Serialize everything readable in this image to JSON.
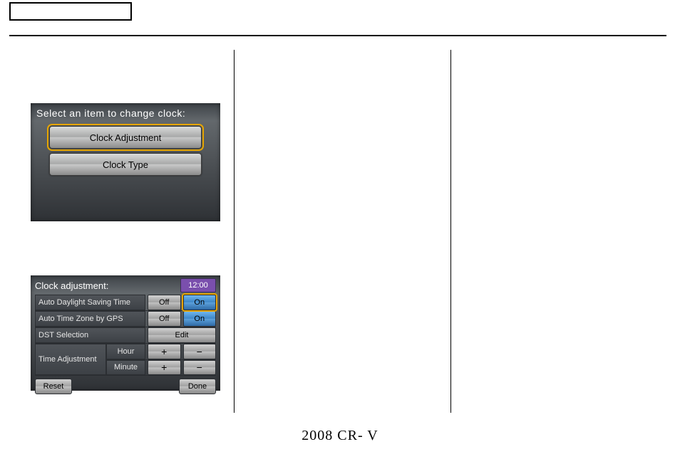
{
  "footer": "2008  CR- V",
  "screen1": {
    "title": "Select an item to change clock:",
    "buttons": [
      {
        "label": "Clock Adjustment",
        "selected": true
      },
      {
        "label": "Clock Type",
        "selected": false
      }
    ]
  },
  "screen2": {
    "title": "Clock adjustment:",
    "clock": "12:00",
    "rows": {
      "auto_dst": {
        "label": "Auto Daylight Saving Time",
        "off": "Off",
        "on": "On",
        "value": "On",
        "highlight": true
      },
      "auto_tz": {
        "label": "Auto Time Zone by GPS",
        "off": "Off",
        "on": "On",
        "value": "On",
        "highlight": false
      },
      "dst_select": {
        "label": "DST Selection",
        "action": "Edit"
      }
    },
    "time_adjustment": {
      "label": "Time Adjustment",
      "hour": {
        "label": "Hour",
        "plus": "+",
        "minus": "−"
      },
      "minute": {
        "label": "Minute",
        "plus": "+",
        "minus": "−"
      }
    },
    "reset_label": "Reset",
    "done_label": "Done"
  }
}
